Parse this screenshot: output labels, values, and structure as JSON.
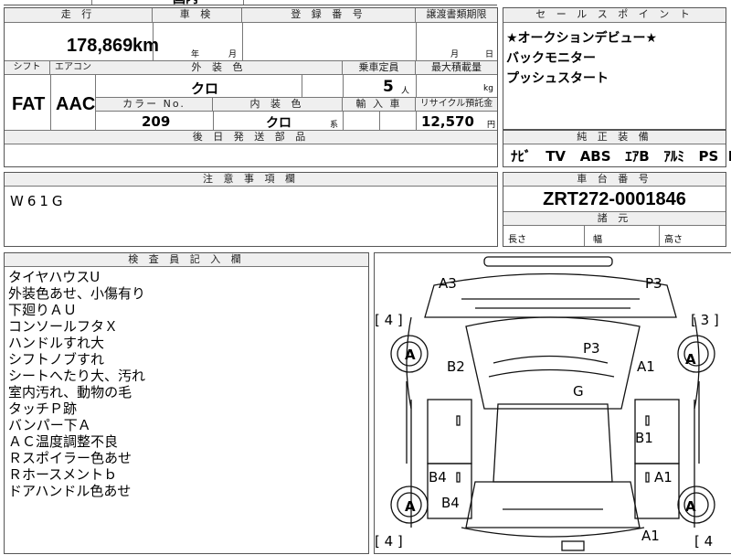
{
  "top_strip": {
    "partial": "国内"
  },
  "sheet": {
    "mileage_label": "走 行",
    "mileage_value": "178,869",
    "mileage_unit": "km",
    "inspection_label": "車 検",
    "inspection_year_unit": "年",
    "inspection_month_unit": "月",
    "registration_label": "登 録 番 号",
    "transfer_label": "譲渡書類期限",
    "transfer_month_unit": "月",
    "transfer_day_unit": "日",
    "shift_label": "シフト",
    "shift_value": "FAT",
    "ac_label": "エアコン",
    "ac_value": "AAC",
    "exterior_color_label": "外 装 色",
    "exterior_color_value": "クロ",
    "capacity_label": "乗車定員",
    "capacity_value": "5",
    "capacity_unit": "人",
    "max_load_label": "最大積載量",
    "max_load_unit": "kg",
    "color_no_label": "カラー No.",
    "color_no_value": "209",
    "interior_color_label": "内 装 色",
    "interior_color_value": "クロ",
    "interior_color_suffix": "系",
    "import_label": "輸 入 車",
    "recycle_label": "リサイクル預託金",
    "recycle_value": "12,570",
    "recycle_unit": "円",
    "later_parts_label": "後 日 発 送 部 品"
  },
  "sales_point": {
    "label": "セ ー ル ス ポ イ ン ト",
    "lines": [
      "★オークションデビュー★",
      "バックモニター",
      "プッシュスタート"
    ]
  },
  "equipment": {
    "label": "純 正 装 備",
    "items": [
      "ﾅﾋﾞ",
      "TV",
      "ABS",
      "ｴｱB",
      "ｱﾙﾐ",
      "PS",
      "PW"
    ]
  },
  "notes": {
    "label": "注 意 事 項 欄",
    "value": "W61G"
  },
  "chassis": {
    "label": "車 台 番 号",
    "value": "ZRT272-0001846"
  },
  "specs": {
    "label": "諸 元",
    "length_label": "長さ",
    "width_label": "幅",
    "height_label": "高さ"
  },
  "inspector": {
    "label": "検 査 員 記 入 欄",
    "remarks": [
      "タイヤハウスU",
      "外装色あせ、小傷有り",
      "下廻りＡＵ",
      "コンソールフタＸ",
      "ハンドルすれ大",
      "シフトノブすれ",
      "シートへたり大、汚れ",
      "室内汚れ、動物の毛",
      "タッチＰ跡",
      "バンパー下Ａ",
      "ＡＣ温度調整不良",
      "Ｒスポイラー色あせ",
      "Ｒホースメントｂ",
      "ドアハンドル色あせ"
    ]
  },
  "damage_map": {
    "codes": {
      "a3": "A3",
      "p3_top": "P3",
      "p3_mid": "P3",
      "b2": "B2",
      "a1_right_upper": "A1",
      "g": "G",
      "b1": "B1",
      "b4_left_upper": "B4",
      "a1_right_lower": "A1",
      "b4_left_lower": "B4",
      "a1_bottom": "A1"
    },
    "tires": {
      "front_left": "A",
      "front_right": "A",
      "rear_left": "A",
      "rear_right": "A"
    },
    "tread": {
      "front_left": "[ 4 ]",
      "front_right": "[ 3 ]",
      "rear_left": "[ 4 ]",
      "rear_right": "[ 4"
    }
  }
}
